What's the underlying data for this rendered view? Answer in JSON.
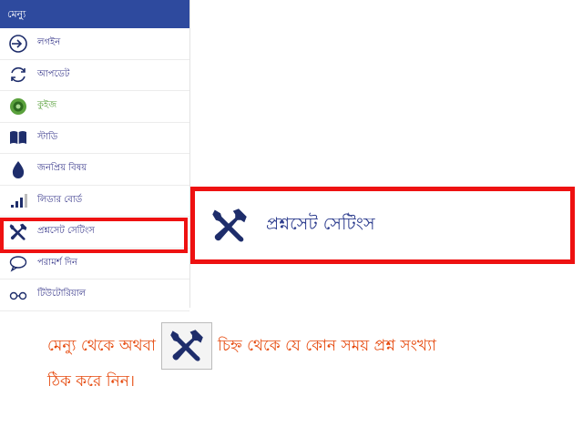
{
  "menu": {
    "header": "মেন্যু",
    "items": [
      {
        "label": "লগইন",
        "icon": "login-icon"
      },
      {
        "label": "আপডেট",
        "icon": "update-icon"
      },
      {
        "label": "কুইজ",
        "icon": "quiz-icon"
      },
      {
        "label": "স্টাডি",
        "icon": "book-icon"
      },
      {
        "label": "জনপ্রিয় বিষয়",
        "icon": "drop-icon"
      },
      {
        "label": "লিডার বোর্ড",
        "icon": "signal-bars-icon"
      },
      {
        "label": "প্রশ্নসেট সেটিংস",
        "icon": "tools-icon"
      },
      {
        "label": "পরামর্শ দিন",
        "icon": "comment-icon"
      },
      {
        "label": "টিউটোরিয়াল",
        "icon": "glasses-icon"
      }
    ]
  },
  "panel": {
    "label": "প্রশ্নসেট সেটিংস",
    "icon": "tools-icon"
  },
  "instruction": {
    "part1": "মেন্যু থেকে অথবা",
    "part2": "চিহ্ন থেকে যে কোন সময় প্রশ্ন সংখ্যা",
    "part3": "ঠিক করে নিন।",
    "icon": "tools-icon"
  },
  "colors": {
    "header_bg": "#2e4a9e",
    "icon_navy": "#1e2d6b",
    "highlight": "#ee1111",
    "instruction_text": "#e64a0e",
    "quiz_green": "#5aa13c"
  }
}
